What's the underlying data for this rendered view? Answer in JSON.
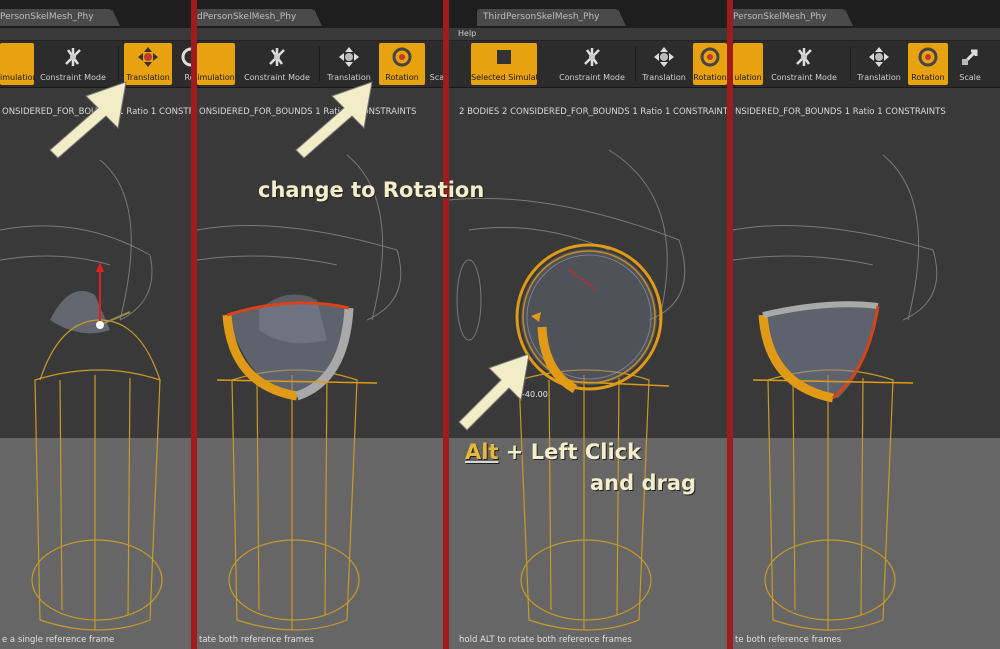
{
  "panels": [
    {
      "tab": "PersonSkelMesh_Phy",
      "help": "",
      "toolbar": [
        {
          "label": "imulation",
          "active": true
        },
        {
          "label": "Constraint Mode",
          "active": false
        },
        {
          "label": "Translation",
          "active": true
        },
        {
          "label": "Rot",
          "active": false
        }
      ],
      "stats": "ONSIDERED_FOR_BOUNDS  1 Ratio  1 CONSTRAIN",
      "status": "e a single reference frame"
    },
    {
      "tab": "dPersonSkelMesh_Phy",
      "help": "",
      "toolbar": [
        {
          "label": "imulation",
          "active": true
        },
        {
          "label": "Constraint Mode",
          "active": false
        },
        {
          "label": "Translation",
          "active": false
        },
        {
          "label": "Rotation",
          "active": true
        },
        {
          "label": "Sca",
          "active": false
        }
      ],
      "stats": "ONSIDERED_FOR_BOUNDS  1 Ratio  1 CONSTRAINTS",
      "status": "tate both reference frames"
    },
    {
      "tab": "ThirdPersonSkelMesh_Phy",
      "help": "Help",
      "toolbar": [
        {
          "label": "Selected Simulation",
          "active": true
        },
        {
          "label": "Constraint Mode",
          "active": false
        },
        {
          "label": "Translation",
          "active": false
        },
        {
          "label": "Rotation",
          "active": true
        }
      ],
      "stats": "2 BODIES  2 CONSIDERED_FOR_BOUNDS  1 Ratio  1 CONSTRAINTS",
      "status": "hold ALT to rotate both reference frames",
      "angle": "-40.00"
    },
    {
      "tab": "PersonSkelMesh_Phy",
      "help": "",
      "toolbar": [
        {
          "label": "ulation",
          "active": true
        },
        {
          "label": "Constraint Mode",
          "active": false
        },
        {
          "label": "Translation",
          "active": false
        },
        {
          "label": "Rotation",
          "active": true
        },
        {
          "label": "Scale",
          "active": false
        }
      ],
      "stats": "NSIDERED_FOR_BOUNDS  1 Ratio  1 CONSTRAINTS",
      "status": "te both reference frames"
    }
  ],
  "annotations": {
    "change_to_rotation": "change to Rotation",
    "alt_key": "Alt",
    "left_click": " + Left Click",
    "and_drag": "and drag"
  },
  "colors": {
    "divider": "#a01c1c",
    "toolbar_active": "#e8a20f",
    "gizmo_orange": "#e09a16",
    "arrow_fill": "#f2edc6",
    "wire": "#c89a28"
  },
  "icons": [
    "constraint-mode-icon",
    "translation-icon",
    "rotation-icon",
    "scale-icon",
    "simulation-icon"
  ]
}
